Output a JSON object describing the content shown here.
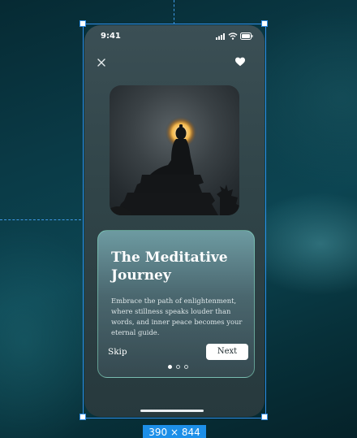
{
  "status_bar": {
    "time": "9:41"
  },
  "onboarding": {
    "title": "The Meditative Journey",
    "description": "Embrace the path of enlightenment, where stillness speaks louder than words, and inner peace becomes your eternal guide.",
    "skip_label": "Skip",
    "next_label": "Next",
    "page_indicator": {
      "total": 3,
      "current": 1
    }
  },
  "canvas": {
    "frame_size_label": "390 × 844"
  },
  "icons": {
    "close": "close-icon",
    "favorite": "heart-icon",
    "signal": "signal-icon",
    "wifi": "wifi-icon",
    "battery": "battery-icon"
  },
  "colors": {
    "selection": "#2f8de6",
    "card_border": "#82d7be",
    "background": "#0a3a46"
  }
}
